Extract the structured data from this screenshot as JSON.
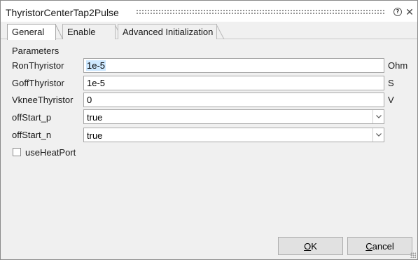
{
  "window": {
    "title": "ThyristorCenterTap2Pulse",
    "help_icon": "help-icon",
    "close_icon": "close-icon"
  },
  "tabs": [
    {
      "label": "General",
      "active": true
    },
    {
      "label": "Enable",
      "active": false
    },
    {
      "label": "Advanced Initialization",
      "active": false
    }
  ],
  "parameters": {
    "section_label": "Parameters",
    "fields": [
      {
        "label": "RonThyristor",
        "value": "1e-5",
        "unit": "Ohm"
      },
      {
        "label": "GoffThyristor",
        "value": "1e-5",
        "unit": "S"
      },
      {
        "label": "VkneeThyristor",
        "value": "0",
        "unit": "V"
      }
    ],
    "combos": [
      {
        "label": "offStart_p",
        "value": "true"
      },
      {
        "label": "offStart_n",
        "value": "true"
      }
    ],
    "checkbox": {
      "label": "useHeatPort",
      "checked": false
    }
  },
  "buttons": {
    "ok_mnemonic": "O",
    "ok_rest": "K",
    "cancel_mnemonic": "C",
    "cancel_rest": "ancel"
  },
  "colors": {
    "selection": "#cde8ff",
    "window_bg": "#f0f0f0",
    "button_bg": "#e1e1e1"
  }
}
